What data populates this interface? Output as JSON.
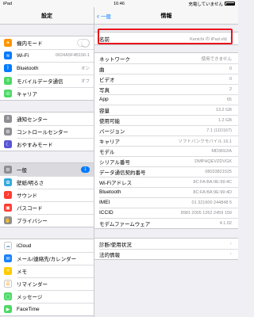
{
  "statusbar": {
    "carrier": "iPad",
    "time": "16:46",
    "battery_label": "充電していません"
  },
  "sidebar": {
    "title": "設定",
    "groups": [
      [
        {
          "label": "機内モード",
          "color": "#ff9500",
          "icon": "airplane-icon",
          "glyph": "✈"
        },
        {
          "label": "Wi-Fi",
          "value": "0024A5F4B156-1",
          "color": "#007aff",
          "icon": "wifi-icon",
          "glyph": "≋"
        },
        {
          "label": "Bluetooth",
          "value": "オン",
          "color": "#007aff",
          "icon": "bluetooth-icon",
          "glyph": "ᛒ"
        },
        {
          "label": "モバイルデータ通信",
          "value": "オフ",
          "color": "#4cd964",
          "icon": "cellular-icon",
          "glyph": "≡"
        },
        {
          "label": "キャリア",
          "color": "#4cd964",
          "icon": "carrier-icon",
          "glyph": "☏"
        }
      ],
      [
        {
          "label": "通知センター",
          "color": "#8e8e93",
          "icon": "notification-center-icon",
          "glyph": "≡"
        },
        {
          "label": "コントロールセンター",
          "color": "#8e8e93",
          "icon": "control-center-icon",
          "glyph": "⚙"
        },
        {
          "label": "おやすみモード",
          "color": "#5856d6",
          "icon": "moon-icon",
          "glyph": "☾"
        }
      ],
      [
        {
          "label": "一般",
          "badge": "1",
          "color": "#8e8e93",
          "icon": "gear-icon",
          "glyph": "⚙"
        },
        {
          "label": "壁紙/明るさ",
          "color": "#34aadc",
          "icon": "wallpaper-icon",
          "glyph": "✿"
        },
        {
          "label": "サウンド",
          "color": "#ff3b30",
          "icon": "sound-icon",
          "glyph": "♪"
        },
        {
          "label": "パスコード",
          "color": "#ff3b30",
          "icon": "lock-icon",
          "glyph": "▣"
        },
        {
          "label": "プライバシー",
          "color": "#8e8e93",
          "icon": "hand-icon",
          "glyph": "✋"
        }
      ],
      [
        {
          "label": "iCloud",
          "color": "#ffffff",
          "icon": "cloud-icon",
          "glyph": "☁",
          "glyph_color": "#7fb2e5",
          "bordered": true
        },
        {
          "label": "メール/連絡先/カレンダー",
          "color": "#1a82fb",
          "icon": "mail-icon",
          "glyph": "✉"
        },
        {
          "label": "メモ",
          "color": "#ffcc00",
          "icon": "notes-icon",
          "glyph": "≡"
        },
        {
          "label": "リマインダー",
          "color": "#ffffff",
          "icon": "reminders-icon",
          "glyph": "☰",
          "glyph_color": "#ff9500",
          "bordered": true
        },
        {
          "label": "メッセージ",
          "color": "#4cd964",
          "icon": "messages-icon",
          "glyph": "◯"
        },
        {
          "label": "FaceTime",
          "color": "#4cd964",
          "icon": "facetime-icon",
          "glyph": "▶"
        }
      ]
    ]
  },
  "main": {
    "title": "情報",
    "back_label": "一般",
    "name_row": {
      "label": "名前",
      "value": "Kenichi の iPad old"
    },
    "info_rows": [
      {
        "label": "ネットワーク",
        "value": "使用できません"
      },
      {
        "label": "曲",
        "value": "0"
      },
      {
        "label": "ビデオ",
        "value": "0"
      },
      {
        "label": "写真",
        "value": "2"
      },
      {
        "label": "App",
        "value": "65"
      },
      {
        "label": "容量",
        "value": "13.2 GB"
      },
      {
        "label": "使用可能",
        "value": "1.2 GB"
      },
      {
        "label": "バージョン",
        "value": "7.1 (11D167)"
      },
      {
        "label": "キャリア",
        "value": "ソフトバンクモバイル 16.1"
      },
      {
        "label": "モデル",
        "value": "MD369J/A"
      },
      {
        "label": "シリアル番号",
        "value": "DMPHQEVZDVGK"
      },
      {
        "label": "データ通信契約番号",
        "value": "08033821525"
      },
      {
        "label": "Wi-Fiアドレス",
        "value": "8C:FA:BA:9E:99:4C"
      },
      {
        "label": "Bluetooth",
        "value": "8C:FA:BA:9E:99:4D"
      },
      {
        "label": "IMEI",
        "value": "01 321600 244848 5"
      },
      {
        "label": "ICCID",
        "value": "8981 2005 1262 2459 159"
      },
      {
        "label": "モデムファームウェア",
        "value": "4.1.02"
      }
    ],
    "bottom_rows": [
      {
        "label": "診断/使用状況"
      },
      {
        "label": "法的情報"
      }
    ]
  }
}
